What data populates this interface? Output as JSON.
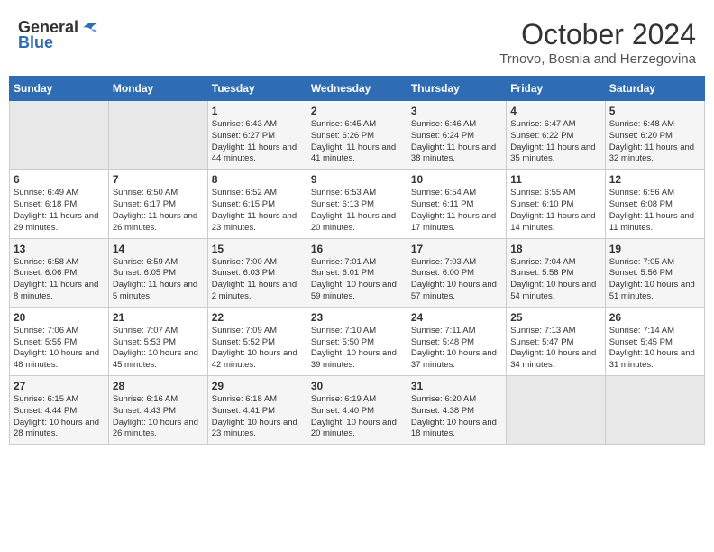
{
  "header": {
    "logo_line1": "General",
    "logo_line2": "Blue",
    "month_year": "October 2024",
    "location": "Trnovo, Bosnia and Herzegovina"
  },
  "days_of_week": [
    "Sunday",
    "Monday",
    "Tuesday",
    "Wednesday",
    "Thursday",
    "Friday",
    "Saturday"
  ],
  "weeks": [
    [
      {
        "day": "",
        "empty": true
      },
      {
        "day": "",
        "empty": true
      },
      {
        "day": "1",
        "sunrise": "Sunrise: 6:43 AM",
        "sunset": "Sunset: 6:27 PM",
        "daylight": "Daylight: 11 hours and 44 minutes."
      },
      {
        "day": "2",
        "sunrise": "Sunrise: 6:45 AM",
        "sunset": "Sunset: 6:26 PM",
        "daylight": "Daylight: 11 hours and 41 minutes."
      },
      {
        "day": "3",
        "sunrise": "Sunrise: 6:46 AM",
        "sunset": "Sunset: 6:24 PM",
        "daylight": "Daylight: 11 hours and 38 minutes."
      },
      {
        "day": "4",
        "sunrise": "Sunrise: 6:47 AM",
        "sunset": "Sunset: 6:22 PM",
        "daylight": "Daylight: 11 hours and 35 minutes."
      },
      {
        "day": "5",
        "sunrise": "Sunrise: 6:48 AM",
        "sunset": "Sunset: 6:20 PM",
        "daylight": "Daylight: 11 hours and 32 minutes."
      }
    ],
    [
      {
        "day": "6",
        "sunrise": "Sunrise: 6:49 AM",
        "sunset": "Sunset: 6:18 PM",
        "daylight": "Daylight: 11 hours and 29 minutes."
      },
      {
        "day": "7",
        "sunrise": "Sunrise: 6:50 AM",
        "sunset": "Sunset: 6:17 PM",
        "daylight": "Daylight: 11 hours and 26 minutes."
      },
      {
        "day": "8",
        "sunrise": "Sunrise: 6:52 AM",
        "sunset": "Sunset: 6:15 PM",
        "daylight": "Daylight: 11 hours and 23 minutes."
      },
      {
        "day": "9",
        "sunrise": "Sunrise: 6:53 AM",
        "sunset": "Sunset: 6:13 PM",
        "daylight": "Daylight: 11 hours and 20 minutes."
      },
      {
        "day": "10",
        "sunrise": "Sunrise: 6:54 AM",
        "sunset": "Sunset: 6:11 PM",
        "daylight": "Daylight: 11 hours and 17 minutes."
      },
      {
        "day": "11",
        "sunrise": "Sunrise: 6:55 AM",
        "sunset": "Sunset: 6:10 PM",
        "daylight": "Daylight: 11 hours and 14 minutes."
      },
      {
        "day": "12",
        "sunrise": "Sunrise: 6:56 AM",
        "sunset": "Sunset: 6:08 PM",
        "daylight": "Daylight: 11 hours and 11 minutes."
      }
    ],
    [
      {
        "day": "13",
        "sunrise": "Sunrise: 6:58 AM",
        "sunset": "Sunset: 6:06 PM",
        "daylight": "Daylight: 11 hours and 8 minutes."
      },
      {
        "day": "14",
        "sunrise": "Sunrise: 6:59 AM",
        "sunset": "Sunset: 6:05 PM",
        "daylight": "Daylight: 11 hours and 5 minutes."
      },
      {
        "day": "15",
        "sunrise": "Sunrise: 7:00 AM",
        "sunset": "Sunset: 6:03 PM",
        "daylight": "Daylight: 11 hours and 2 minutes."
      },
      {
        "day": "16",
        "sunrise": "Sunrise: 7:01 AM",
        "sunset": "Sunset: 6:01 PM",
        "daylight": "Daylight: 10 hours and 59 minutes."
      },
      {
        "day": "17",
        "sunrise": "Sunrise: 7:03 AM",
        "sunset": "Sunset: 6:00 PM",
        "daylight": "Daylight: 10 hours and 57 minutes."
      },
      {
        "day": "18",
        "sunrise": "Sunrise: 7:04 AM",
        "sunset": "Sunset: 5:58 PM",
        "daylight": "Daylight: 10 hours and 54 minutes."
      },
      {
        "day": "19",
        "sunrise": "Sunrise: 7:05 AM",
        "sunset": "Sunset: 5:56 PM",
        "daylight": "Daylight: 10 hours and 51 minutes."
      }
    ],
    [
      {
        "day": "20",
        "sunrise": "Sunrise: 7:06 AM",
        "sunset": "Sunset: 5:55 PM",
        "daylight": "Daylight: 10 hours and 48 minutes."
      },
      {
        "day": "21",
        "sunrise": "Sunrise: 7:07 AM",
        "sunset": "Sunset: 5:53 PM",
        "daylight": "Daylight: 10 hours and 45 minutes."
      },
      {
        "day": "22",
        "sunrise": "Sunrise: 7:09 AM",
        "sunset": "Sunset: 5:52 PM",
        "daylight": "Daylight: 10 hours and 42 minutes."
      },
      {
        "day": "23",
        "sunrise": "Sunrise: 7:10 AM",
        "sunset": "Sunset: 5:50 PM",
        "daylight": "Daylight: 10 hours and 39 minutes."
      },
      {
        "day": "24",
        "sunrise": "Sunrise: 7:11 AM",
        "sunset": "Sunset: 5:48 PM",
        "daylight": "Daylight: 10 hours and 37 minutes."
      },
      {
        "day": "25",
        "sunrise": "Sunrise: 7:13 AM",
        "sunset": "Sunset: 5:47 PM",
        "daylight": "Daylight: 10 hours and 34 minutes."
      },
      {
        "day": "26",
        "sunrise": "Sunrise: 7:14 AM",
        "sunset": "Sunset: 5:45 PM",
        "daylight": "Daylight: 10 hours and 31 minutes."
      }
    ],
    [
      {
        "day": "27",
        "sunrise": "Sunrise: 6:15 AM",
        "sunset": "Sunset: 4:44 PM",
        "daylight": "Daylight: 10 hours and 28 minutes."
      },
      {
        "day": "28",
        "sunrise": "Sunrise: 6:16 AM",
        "sunset": "Sunset: 4:43 PM",
        "daylight": "Daylight: 10 hours and 26 minutes."
      },
      {
        "day": "29",
        "sunrise": "Sunrise: 6:18 AM",
        "sunset": "Sunset: 4:41 PM",
        "daylight": "Daylight: 10 hours and 23 minutes."
      },
      {
        "day": "30",
        "sunrise": "Sunrise: 6:19 AM",
        "sunset": "Sunset: 4:40 PM",
        "daylight": "Daylight: 10 hours and 20 minutes."
      },
      {
        "day": "31",
        "sunrise": "Sunrise: 6:20 AM",
        "sunset": "Sunset: 4:38 PM",
        "daylight": "Daylight: 10 hours and 18 minutes."
      },
      {
        "day": "",
        "empty": true
      },
      {
        "day": "",
        "empty": true
      }
    ]
  ]
}
